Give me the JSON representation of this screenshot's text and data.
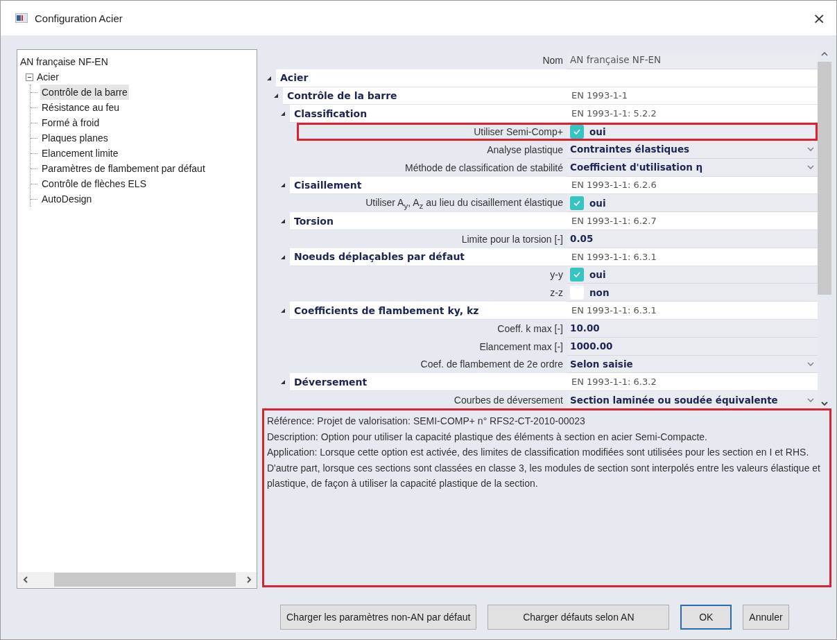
{
  "window": {
    "title": "Configuration Acier",
    "close": "×"
  },
  "tree": {
    "label": "AN française NF-EN",
    "children": [
      {
        "label": "Acier",
        "expanded": true,
        "children": [
          {
            "label": "Contrôle de la barre",
            "selected": true
          },
          {
            "label": "Résistance au feu",
            "selected": false
          },
          {
            "label": "Formé à froid",
            "selected": false
          },
          {
            "label": "Plaques planes",
            "selected": false
          },
          {
            "label": "Elancement limite",
            "selected": false
          },
          {
            "label": "Paramètres de flambement par défaut",
            "selected": false
          },
          {
            "label": "Contrôle de flèches ELS",
            "selected": false
          },
          {
            "label": "AutoDesign",
            "selected": false
          }
        ]
      }
    ]
  },
  "properties": {
    "rows": [
      {
        "kind": "plain",
        "label": "Nom",
        "value": "AN française NF-EN",
        "highlighted": false
      },
      {
        "kind": "group",
        "label": "Acier",
        "expanded": true,
        "children": [
          {
            "kind": "group",
            "label": "Contrôle de la barre",
            "value": "EN 1993-1-1",
            "expanded": true,
            "children": [
              {
                "kind": "group",
                "label": "Classification",
                "value": "EN 1993-1-1: 5.2.2",
                "expanded": true,
                "children": [
                  {
                    "kind": "checkbox",
                    "label": "Utiliser Semi-Comp+",
                    "checked": true,
                    "value": "oui",
                    "highlighted": true
                  },
                  {
                    "kind": "dropdown",
                    "label": "Analyse plastique",
                    "value": "Contraintes élastiques",
                    "highlighted": false
                  },
                  {
                    "kind": "dropdown",
                    "label": "Méthode de classification de stabilité",
                    "value": "Coefficient d'utilisation η",
                    "highlighted": false
                  }
                ]
              },
              {
                "kind": "group",
                "label": "Cisaillement",
                "value": "EN 1993-1-1: 6.2.6",
                "expanded": true,
                "children": [
                  {
                    "kind": "checkbox",
                    "label": "Utiliser A$_{y}$, A$_{z}$ au lieu du cisaillement élastique",
                    "checked": true,
                    "value": "oui",
                    "highlighted": false
                  }
                ]
              },
              {
                "kind": "group",
                "label": "Torsion",
                "value": "EN 1993-1-1: 6.2.7",
                "expanded": true,
                "children": [
                  {
                    "kind": "value",
                    "label": "Limite pour la torsion [-]",
                    "value": "0.05",
                    "highlighted": false
                  }
                ]
              },
              {
                "kind": "group",
                "label": "Noeuds déplaçables par défaut",
                "value": "EN 1993-1-1: 6.3.1",
                "expanded": true,
                "children": [
                  {
                    "kind": "checkbox",
                    "label": "y-y",
                    "checked": true,
                    "value": "oui",
                    "highlighted": false
                  },
                  {
                    "kind": "checkbox",
                    "label": "z-z",
                    "checked": false,
                    "value": "non",
                    "highlighted": false
                  }
                ]
              },
              {
                "kind": "group",
                "label": "Coefficients de flambement ky, kz",
                "value": "EN 1993-1-1: 6.3.1",
                "expanded": true,
                "children": [
                  {
                    "kind": "value",
                    "label": "Coeff. k max [-]",
                    "value": "10.00",
                    "highlighted": false
                  },
                  {
                    "kind": "value",
                    "label": "Elancement max [-]",
                    "value": "1000.00",
                    "highlighted": false
                  },
                  {
                    "kind": "dropdown",
                    "label": "Coef. de flambement de 2e ordre",
                    "value": "Selon saisie",
                    "highlighted": false
                  }
                ]
              },
              {
                "kind": "group",
                "label": "Déversement",
                "value": "EN 1993-1-1: 6.3.2",
                "expanded": true,
                "children": [
                  {
                    "kind": "dropdown",
                    "label": "Courbes de déversement",
                    "value": "Section laminée ou soudée équivalente",
                    "highlighted": false
                  }
                ]
              }
            ]
          }
        ]
      }
    ]
  },
  "description": {
    "highlighted": true,
    "paragraphs": [
      "Référence: Projet de valorisation: SEMI-COMP+ n° RFS2-CT-2010-00023",
      "Description: Option pour utiliser la capacité plastique des éléments à section en acier Semi-Compacte.",
      "Application: Lorsque cette option est activée, des limites de classification modifiées sont utilisées pour les section en I et RHS. D'autre part, lorsque ces sections sont classées en classe 3, les modules de section sont interpolés entre les valeurs élastique et plastique, de façon à utiliser la capacité plastique de la section."
    ]
  },
  "buttons": [
    {
      "label": "Charger les paramètres non-AN par défaut",
      "default": false
    },
    {
      "label": "Charger défauts selon AN",
      "default": false
    },
    {
      "label": "OK",
      "default": true
    },
    {
      "label": "Annuler",
      "default": false
    }
  ]
}
